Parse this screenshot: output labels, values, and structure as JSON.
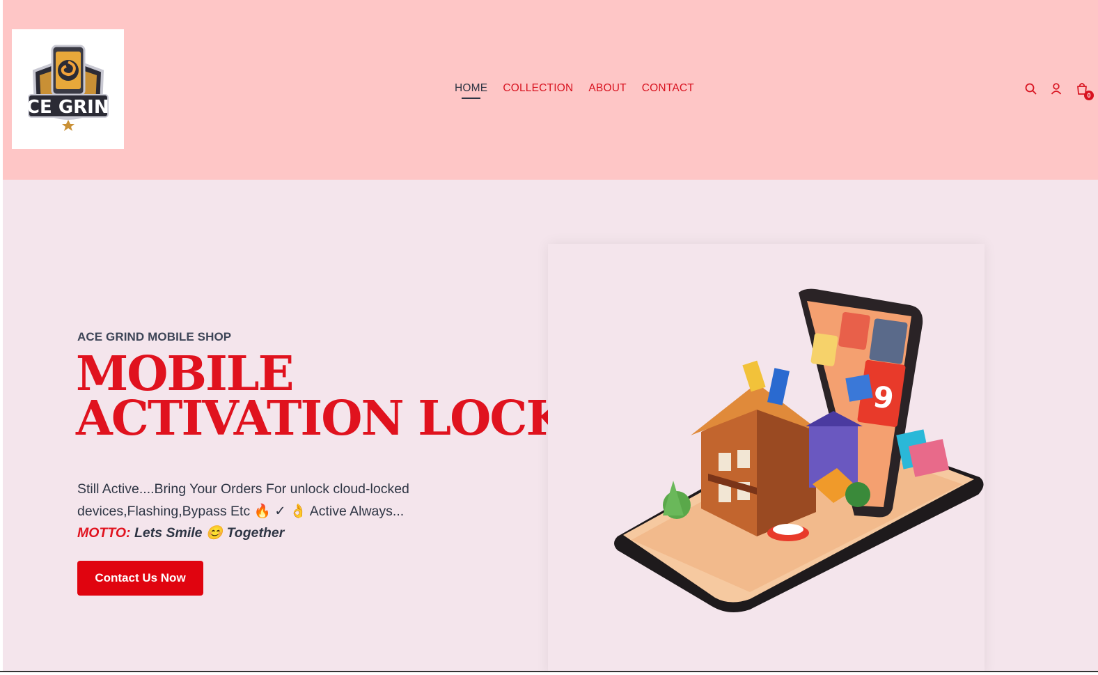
{
  "brand": {
    "logo_text": "ACE GRIND"
  },
  "nav": {
    "items": [
      {
        "label": "HOME",
        "active": true
      },
      {
        "label": "COLLECTION",
        "active": false
      },
      {
        "label": "ABOUT",
        "active": false
      },
      {
        "label": "CONTACT",
        "active": false
      }
    ]
  },
  "header_icons": {
    "search": "search-icon",
    "account": "user-icon",
    "cart": "bag-icon",
    "cart_count": "0"
  },
  "hero": {
    "subtitle": "ACE GRIND MOBILE SHOP",
    "title_line1": "MOBILE",
    "title_line2": "ACTIVATION LOCK!",
    "description": "Still Active....Bring Your Orders For unlock cloud-locked devices,Flashing,Bypass Etc 🔥 ✓ 👌 Active Always...",
    "motto_label": "MOTTO:",
    "motto_text": " Lets Smile 😊 Together",
    "cta_label": "Contact Us Now"
  },
  "colors": {
    "header_bg": "#fec6c6",
    "page_bg": "#f4e5ec",
    "accent": "#e0121e",
    "text": "#2e3544"
  }
}
